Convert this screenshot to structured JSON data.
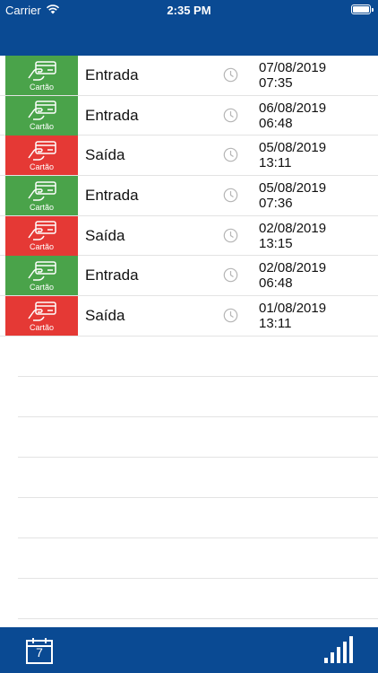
{
  "status_bar": {
    "carrier": "Carrier",
    "time": "2:35 PM"
  },
  "records": [
    {
      "type": "Entrada",
      "kind": "entrada",
      "badge": "Cartão",
      "date": "07/08/2019",
      "time": "07:35"
    },
    {
      "type": "Entrada",
      "kind": "entrada",
      "badge": "Cartão",
      "date": "06/08/2019",
      "time": "06:48"
    },
    {
      "type": "Saída",
      "kind": "saida",
      "badge": "Cartão",
      "date": "05/08/2019",
      "time": "13:11"
    },
    {
      "type": "Entrada",
      "kind": "entrada",
      "badge": "Cartão",
      "date": "05/08/2019",
      "time": "07:36"
    },
    {
      "type": "Saída",
      "kind": "saida",
      "badge": "Cartão",
      "date": "02/08/2019",
      "time": "13:15"
    },
    {
      "type": "Entrada",
      "kind": "entrada",
      "badge": "Cartão",
      "date": "02/08/2019",
      "time": "06:48"
    },
    {
      "type": "Saída",
      "kind": "saida",
      "badge": "Cartão",
      "date": "01/08/2019",
      "time": "13:11"
    }
  ],
  "tabbar": {
    "calendar_day": "7",
    "calendar_icon": "calendar-icon",
    "stats_icon": "signal-bars-icon"
  },
  "colors": {
    "bar": "#0a4a93",
    "entrada": "#4aa34a",
    "saida": "#e53935"
  }
}
